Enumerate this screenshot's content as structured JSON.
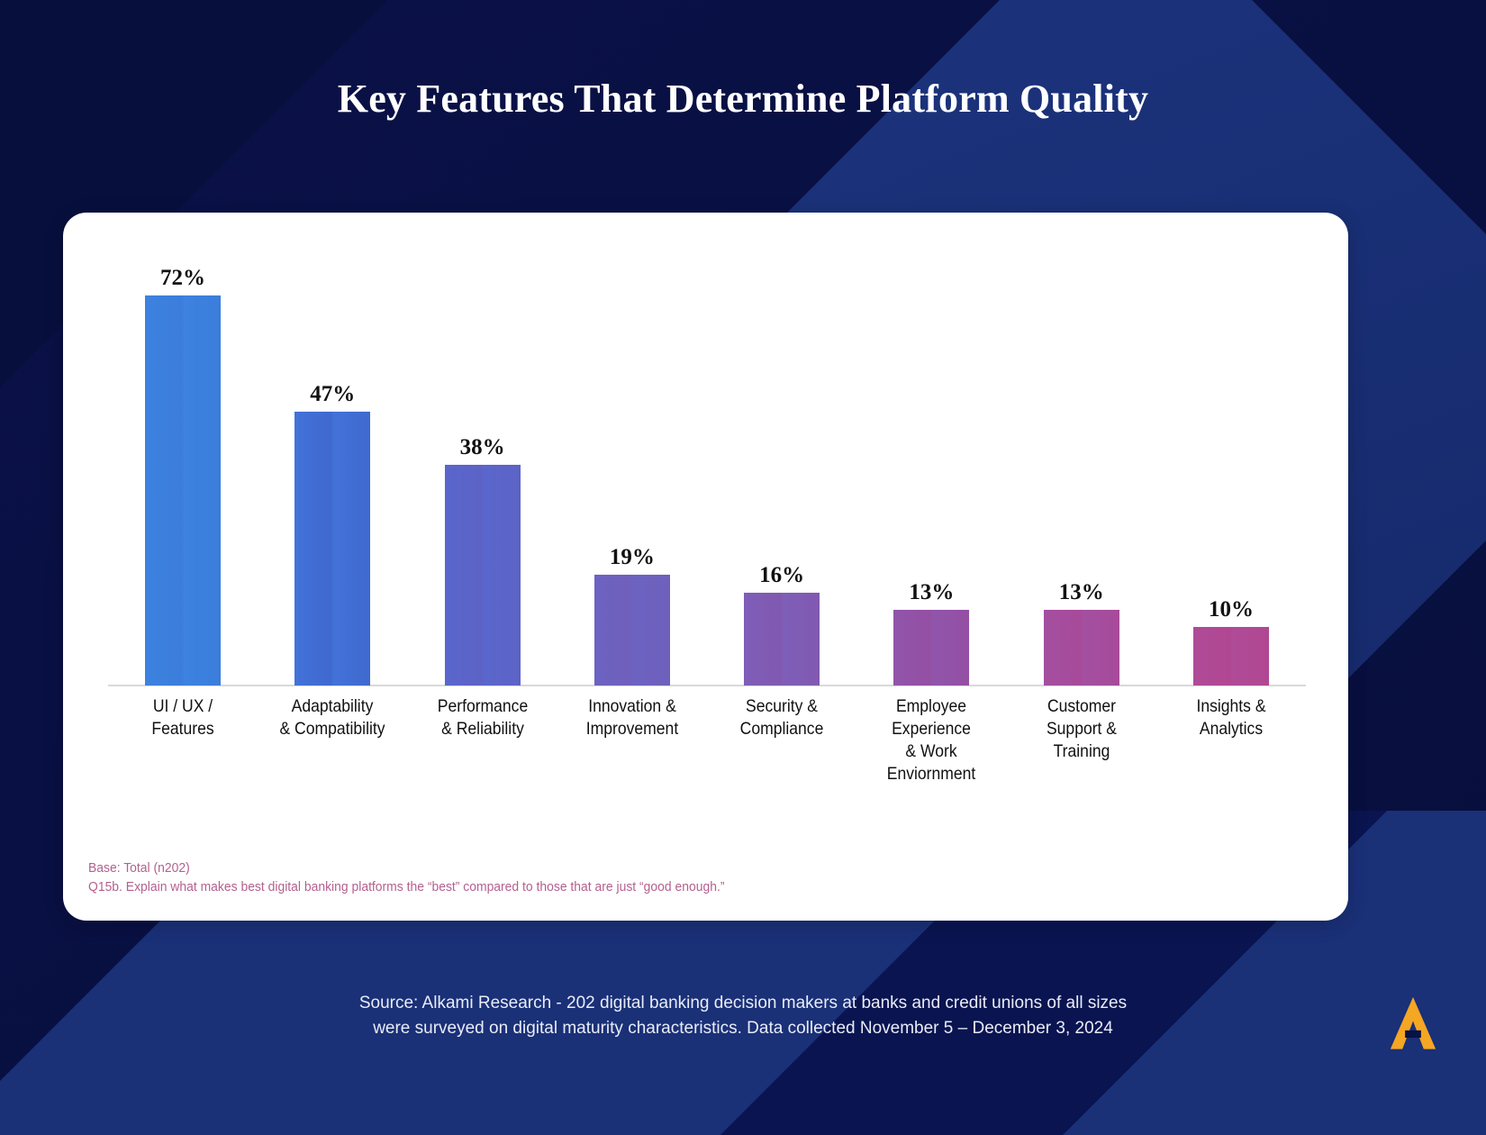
{
  "slide": {
    "title": "Key Features That Determine Platform Quality",
    "background_color": "#081244",
    "accent_color": "#1b3178",
    "card_color": "#ffffff",
    "logo_color": "#f5a623",
    "logo_name": "alkami-logo"
  },
  "footnotes": {
    "line1": "Base: Total (n202)",
    "line2": "Q15b. Explain what makes best digital banking platforms the “best” compared to those that are just “good enough.”"
  },
  "source": {
    "line1": "Source: Alkami Research - 202 digital banking decision makers at banks and credit unions of all sizes",
    "line2": "were surveyed on digital maturity characteristics. Data collected November 5 – December 3, 2024"
  },
  "chart_data": {
    "type": "bar",
    "title": "Key Features That Determine Platform Quality",
    "xlabel": "",
    "ylabel": "",
    "ylim": [
      0,
      80
    ],
    "grid": false,
    "legend": "none",
    "categories": [
      "UI / UX /\nFeatures",
      "Adaptability\n& Compatibility",
      "Performance\n& Reliability",
      "Innovation &\nImprovement",
      "Security &\nCompliance",
      "Employee\nExperience\n& Work\nEnviornment",
      "Customer\nSupport &\nTraining",
      "Insights &\nAnalytics"
    ],
    "values": [
      72,
      47,
      38,
      19,
      16,
      13,
      13,
      10
    ],
    "value_labels": [
      "72%",
      "47%",
      "38%",
      "19%",
      "16%",
      "13%",
      "13%",
      "10%"
    ],
    "bar_colors": [
      "#3d82e0",
      "#4272d8",
      "#5a66cc",
      "#6c62c2",
      "#7e5eb8",
      "#9055ab",
      "#a44fa0",
      "#af4b97"
    ],
    "bar_colors_right": [
      "#3b7ddb",
      "#4069cf",
      "#5c63c6",
      "#6f60bb",
      "#8159b0",
      "#944fa3",
      "#a74a9a",
      "#b14792"
    ]
  }
}
